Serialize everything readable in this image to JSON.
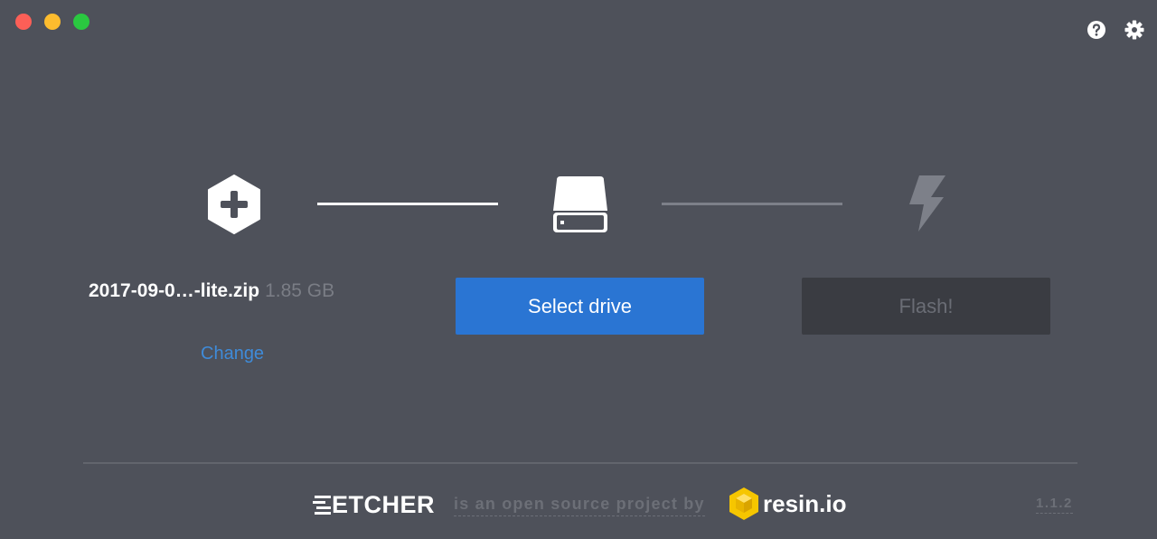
{
  "steps": {
    "image": {
      "icon": "plus-hexagon-icon",
      "filename": "2017-09-0…-lite.zip",
      "size": "1.85 GB",
      "change_label": "Change"
    },
    "drive": {
      "icon": "hard-drive-icon",
      "button_label": "Select drive"
    },
    "flash": {
      "icon": "lightning-bolt-icon",
      "button_label": "Flash!"
    }
  },
  "toolbar": {
    "help_icon": "help-icon",
    "settings_icon": "gear-icon"
  },
  "footer": {
    "logo": "ETCHER",
    "tagline": "is an open source project by",
    "company": "resin.io",
    "version": "1.1.2"
  },
  "colors": {
    "background": "#4e515a",
    "accent": "#2a75d3",
    "link": "#3f8bd9",
    "disabled_button": "#3a3c42"
  }
}
